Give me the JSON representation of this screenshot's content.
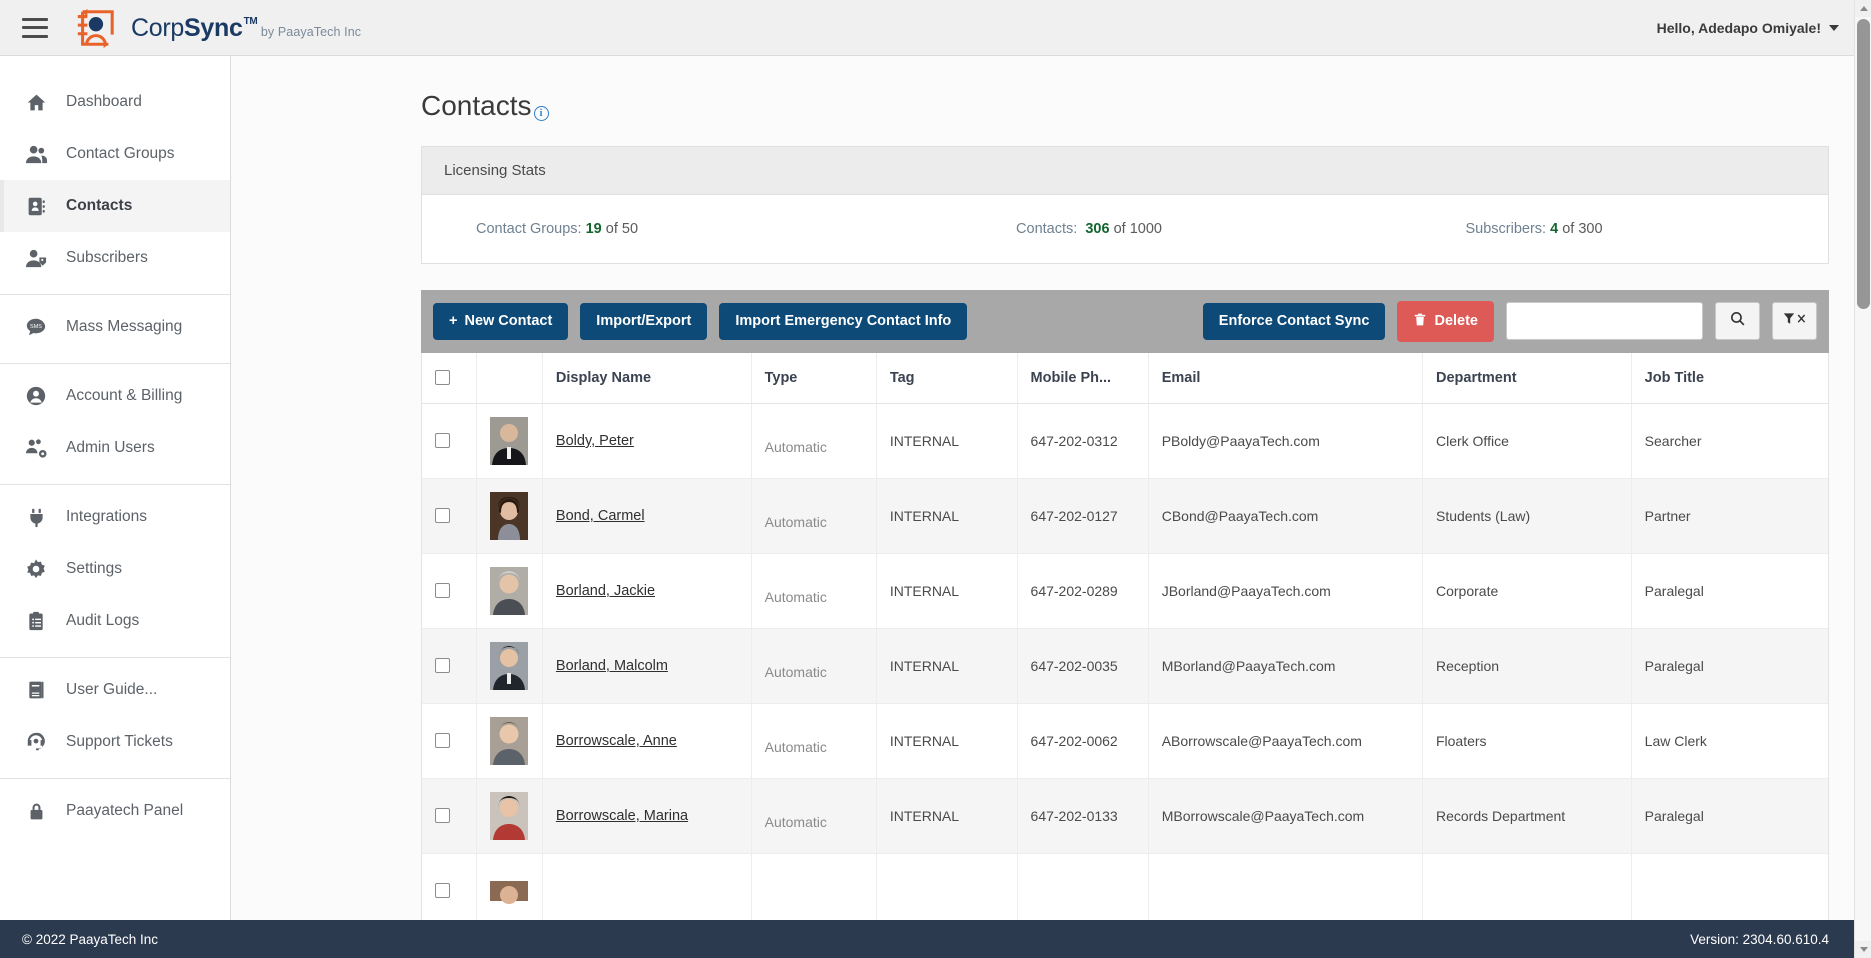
{
  "topbar": {
    "menu_icon": "hamburger-icon",
    "brand_name_light": "Corp",
    "brand_name_bold": "Sync",
    "brand_tm": "TM",
    "brand_sub": "by PaayaTech Inc",
    "greeting": "Hello, Adedapo Omiyale!"
  },
  "sidebar": {
    "groups": [
      {
        "items": [
          {
            "label": "Dashboard",
            "icon": "home-icon",
            "active": false
          },
          {
            "label": "Contact Groups",
            "icon": "users-icon",
            "active": false
          },
          {
            "label": "Contacts",
            "icon": "address-book-icon",
            "active": true
          },
          {
            "label": "Subscribers",
            "icon": "user-tag-icon",
            "active": false
          }
        ]
      },
      {
        "items": [
          {
            "label": "Mass Messaging",
            "icon": "sms-bubble-icon",
            "active": false
          }
        ]
      },
      {
        "items": [
          {
            "label": "Account & Billing",
            "icon": "user-circle-icon",
            "active": false
          },
          {
            "label": "Admin Users",
            "icon": "users-cog-icon",
            "active": false
          }
        ]
      },
      {
        "items": [
          {
            "label": "Integrations",
            "icon": "plug-icon",
            "active": false
          },
          {
            "label": "Settings",
            "icon": "gear-icon",
            "active": false
          },
          {
            "label": "Audit Logs",
            "icon": "clipboard-list-icon",
            "active": false
          }
        ]
      },
      {
        "items": [
          {
            "label": "User Guide...",
            "icon": "book-icon",
            "active": false
          },
          {
            "label": "Support Tickets",
            "icon": "headset-icon",
            "active": false
          }
        ]
      },
      {
        "items": [
          {
            "label": "Paayatech Panel",
            "icon": "lock-icon",
            "active": false
          }
        ]
      }
    ]
  },
  "page": {
    "title": "Contacts",
    "info_icon": "info-icon"
  },
  "licensing": {
    "panel_title": "Licensing Stats",
    "stats": [
      {
        "label": "Contact Groups:",
        "value": "19",
        "denom": "of 50"
      },
      {
        "label": "Contacts:",
        "value": "306",
        "denom": "of 1000"
      },
      {
        "label": "Subscribers:",
        "value": "4",
        "denom": "of 300"
      }
    ]
  },
  "toolbar": {
    "new_contact": "New Contact",
    "new_contact_icon": "plus-icon",
    "import_export": "Import/Export",
    "import_emergency": "Import Emergency Contact Info",
    "enforce_sync": "Enforce Contact Sync",
    "delete": "Delete",
    "delete_icon": "trash-icon",
    "search_value": "",
    "search_placeholder": "",
    "search_icon": "search-icon",
    "filter_clear_icon": "filter-clear-icon"
  },
  "table": {
    "columns": [
      {
        "key": "checkbox",
        "label": ""
      },
      {
        "key": "photo",
        "label": ""
      },
      {
        "key": "display_name",
        "label": "Display Name"
      },
      {
        "key": "type",
        "label": "Type"
      },
      {
        "key": "tag",
        "label": "Tag"
      },
      {
        "key": "mobile_phone",
        "label": "Mobile Ph..."
      },
      {
        "key": "email",
        "label": "Email"
      },
      {
        "key": "department",
        "label": "Department"
      },
      {
        "key": "job_title",
        "label": "Job Title"
      }
    ],
    "rows": [
      {
        "display_name": "Boldy, Peter",
        "type": "Automatic",
        "tag": "INTERNAL",
        "mobile_phone": "647-202-0312",
        "email": "PBoldy@PaayaTech.com",
        "department": "Clerk Office",
        "job_title": "Searcher",
        "avatar_bg": "#6d6258",
        "avatar_tone": "#d9b79a"
      },
      {
        "display_name": "Bond, Carmel",
        "type": "Automatic",
        "tag": "INTERNAL",
        "mobile_phone": "647-202-0127",
        "email": "CBond@PaayaTech.com",
        "department": "Students (Law)",
        "job_title": "Partner",
        "avatar_bg": "#4a3526",
        "avatar_tone": "#e0bda2"
      },
      {
        "display_name": "Borland, Jackie",
        "type": "Automatic",
        "tag": "INTERNAL",
        "mobile_phone": "647-202-0289",
        "email": "JBorland@PaayaTech.com",
        "department": "Corporate",
        "job_title": "Paralegal",
        "avatar_bg": "#9a9a96",
        "avatar_tone": "#e3c4a8"
      },
      {
        "display_name": "Borland, Malcolm",
        "type": "Automatic",
        "tag": "INTERNAL",
        "mobile_phone": "647-202-0035",
        "email": "MBorland@PaayaTech.com",
        "department": "Reception",
        "job_title": "Paralegal",
        "avatar_bg": "#8c8f92",
        "avatar_tone": "#e6c2a4"
      },
      {
        "display_name": "Borrowscale, Anne",
        "type": "Automatic",
        "tag": "INTERNAL",
        "mobile_phone": "647-202-0062",
        "email": "ABorrowscale@PaayaTech.com",
        "department": "Floaters",
        "job_title": "Law Clerk",
        "avatar_bg": "#a39a8c",
        "avatar_tone": "#e8c7ab"
      },
      {
        "display_name": "Borrowscale, Marina",
        "type": "Automatic",
        "tag": "INTERNAL",
        "mobile_phone": "647-202-0133",
        "email": "MBorrowscale@PaayaTech.com",
        "department": "Records Department",
        "job_title": "Paralegal",
        "avatar_bg": "#b33a34",
        "avatar_tone": "#e9c3a6"
      },
      {
        "display_name": "",
        "type": "",
        "tag": "",
        "mobile_phone": "",
        "email": "",
        "department": "",
        "job_title": "",
        "avatar_bg": "#8a6a52",
        "avatar_tone": "#dcb294"
      }
    ]
  },
  "footer": {
    "copyright": "© 2022  PaayaTech Inc",
    "version": "Version: 2304.60.610.4"
  },
  "colors": {
    "brand_navy": "#1b3a63",
    "brand_orange": "#e8622a",
    "primary_button": "#0d4a77",
    "danger_button": "#dd5a57",
    "stat_green": "#14662e",
    "footer_bg": "#2b3a4f",
    "toolbar_bg": "#a8a8a8"
  }
}
